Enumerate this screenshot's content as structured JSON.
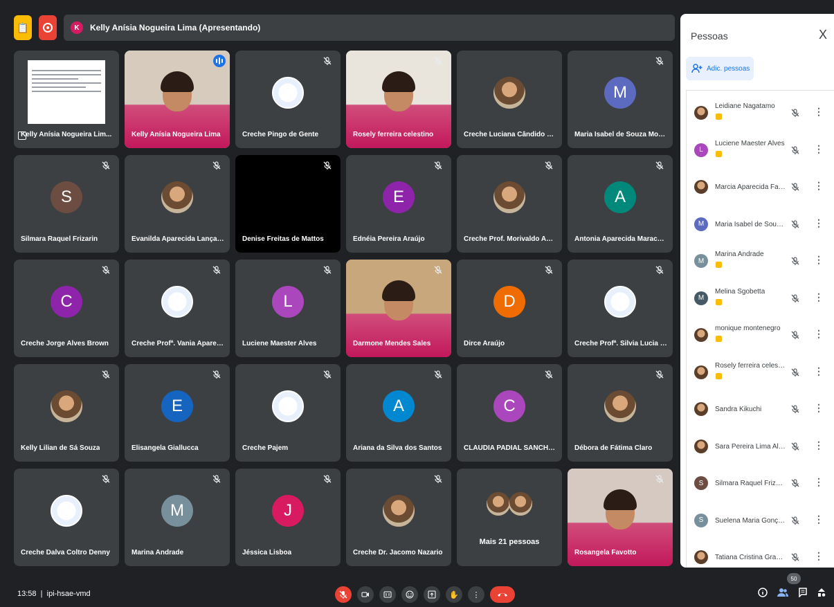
{
  "presenting_banner": {
    "initial": "K",
    "text": "Kelly Anísia Nogueira Lima (Apresentando)"
  },
  "tiles": [
    {
      "name": "Kelly Anísia Nogueira Lim...",
      "kind": "share",
      "muted": false
    },
    {
      "name": "Kelly Anísia Nogueira Lima",
      "kind": "video",
      "muted": false,
      "speaking": true,
      "bg": "#d7cbbd"
    },
    {
      "name": "Creche Pingo de Gente",
      "kind": "logo",
      "muted": true
    },
    {
      "name": "Rosely ferreira celestino",
      "kind": "video",
      "muted": true,
      "bg": "#e9e4dc"
    },
    {
      "name": "Creche Luciana Cândido Carn...",
      "kind": "photo",
      "muted": false
    },
    {
      "name": "Maria Isabel de Souza Moraes",
      "kind": "letter",
      "letter": "M",
      "color": "#5c6bc0",
      "muted": true
    },
    {
      "name": "Silmara Raquel Frizarin",
      "kind": "letter",
      "letter": "S",
      "color": "#6d4c41",
      "muted": true
    },
    {
      "name": "Evanilda Aparecida Lança Rib...",
      "kind": "photo",
      "muted": true
    },
    {
      "name": "Denise Freitas de Mattos",
      "kind": "black",
      "muted": true
    },
    {
      "name": "Ednéia Pereira Araújo",
      "kind": "letter",
      "letter": "E",
      "color": "#8e24aa",
      "muted": true
    },
    {
      "name": "Creche Prof. Morivaldo Anton...",
      "kind": "photo",
      "muted": true
    },
    {
      "name": "Antonia Aparecida Marachini",
      "kind": "letter",
      "letter": "A",
      "color": "#00897b",
      "muted": true
    },
    {
      "name": "Creche Jorge Alves Brown",
      "kind": "letter",
      "letter": "C",
      "color": "#8e24aa",
      "muted": true
    },
    {
      "name": "Creche Profª. Vania Aparecid...",
      "kind": "logo",
      "muted": true
    },
    {
      "name": "Luciene Maester Alves",
      "kind": "letter",
      "letter": "L",
      "color": "#ab47bc",
      "muted": true
    },
    {
      "name": "Darmone Mendes Sales",
      "kind": "video",
      "muted": true,
      "bg": "#c9a77c"
    },
    {
      "name": "Dirce Araújo",
      "kind": "letter",
      "letter": "D",
      "color": "#ef6c00",
      "muted": true
    },
    {
      "name": "Creche Profª. Silvia Lucia Silv...",
      "kind": "logo",
      "muted": true
    },
    {
      "name": "Kelly Lilian de Sá Souza",
      "kind": "photo",
      "muted": true
    },
    {
      "name": "Elisangela Giallucca",
      "kind": "letter",
      "letter": "E",
      "color": "#1565c0",
      "muted": true
    },
    {
      "name": "Creche Pajem",
      "kind": "logo",
      "muted": true
    },
    {
      "name": "Ariana da Silva dos Santos",
      "kind": "letter",
      "letter": "A",
      "color": "#0288d1",
      "muted": true
    },
    {
      "name": "CLAUDIA PADIAL SANCHEZ M...",
      "kind": "letter",
      "letter": "C",
      "color": "#ab47bc",
      "muted": true
    },
    {
      "name": "Débora de Fátima Claro",
      "kind": "photo",
      "muted": true
    },
    {
      "name": "Creche Dalva Coltro Denny",
      "kind": "logo",
      "muted": true
    },
    {
      "name": "Marina Andrade",
      "kind": "letter",
      "letter": "M",
      "color": "#78909c",
      "muted": true
    },
    {
      "name": "Jéssica Lisboa",
      "kind": "letter",
      "letter": "J",
      "color": "#d81b60",
      "muted": true
    },
    {
      "name": "Creche Dr. Jacomo Nazario",
      "kind": "photo",
      "muted": true
    },
    {
      "name": "Mais 21 pessoas",
      "kind": "more",
      "muted": false
    },
    {
      "name": "Rosangela Favotto",
      "kind": "video",
      "muted": true,
      "bg": "#d5c9c2"
    }
  ],
  "panel": {
    "title": "Pessoas",
    "close": "X",
    "add_label": "Adic. pessoas",
    "people": [
      {
        "name": "Leidiane Nagatamo",
        "kind": "photo",
        "host_badge": true
      },
      {
        "name": "Luciene Maester Alves",
        "kind": "letter",
        "letter": "L",
        "color": "#ab47bc",
        "host_badge": true
      },
      {
        "name": "Marcia Aparecida Favaro",
        "kind": "photo",
        "host_badge": false
      },
      {
        "name": "Maria Isabel de Souza M...",
        "kind": "letter",
        "letter": "M",
        "color": "#5c6bc0",
        "host_badge": false
      },
      {
        "name": "Marina Andrade",
        "kind": "letter",
        "letter": "M",
        "color": "#78909c",
        "host_badge": true
      },
      {
        "name": "Melina Sgobetta",
        "kind": "letter",
        "letter": "M",
        "color": "#455a64",
        "host_badge": true
      },
      {
        "name": "monique montenegro",
        "kind": "photo",
        "host_badge": true
      },
      {
        "name": "Rosely ferreira celestino",
        "kind": "photo",
        "host_badge": true
      },
      {
        "name": "Sandra Kikuchi",
        "kind": "photo",
        "host_badge": false
      },
      {
        "name": "Sara Pereira Lima Albuq...",
        "kind": "photo",
        "host_badge": false
      },
      {
        "name": "Silmara Raquel Frizarin",
        "kind": "letter",
        "letter": "S",
        "color": "#6d4c41",
        "host_badge": false
      },
      {
        "name": "Suelena Maria Gonçalves",
        "kind": "letter",
        "letter": "S",
        "color": "#78909c",
        "host_badge": false
      },
      {
        "name": "Tatiana Cristina Granado",
        "kind": "photo",
        "host_badge": false
      }
    ]
  },
  "bottom": {
    "time": "13:58",
    "meeting_code": "ipi-hsae-vmd",
    "participant_count": "50"
  }
}
